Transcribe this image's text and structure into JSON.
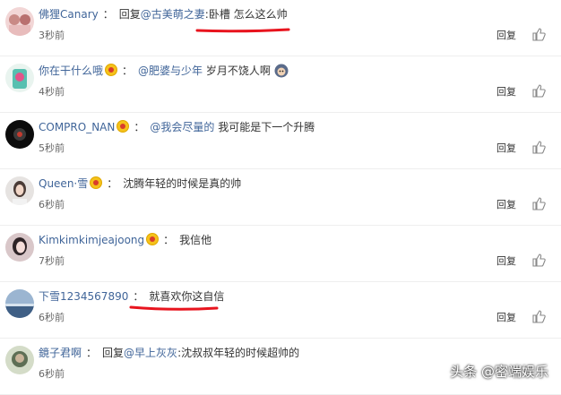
{
  "comments": [
    {
      "user": "佛狸Canary",
      "badge": false,
      "prefix": "回复",
      "mention": "@古美萌之妻",
      "mention_suffix": ":",
      "text": "卧槽 怎么这么帅",
      "time": "3秒前"
    },
    {
      "user": "你在干什么哦",
      "badge": true,
      "prefix": "",
      "mention": "@肥婆与少年",
      "mention_suffix": "",
      "text": "岁月不饶人啊",
      "time": "4秒前"
    },
    {
      "user": "COMPRO_NAN",
      "badge": true,
      "prefix": "",
      "mention": "@我会尽量的",
      "mention_suffix": "",
      "text": "我可能是下一个升腾",
      "time": "5秒前"
    },
    {
      "user": "Queen·雪",
      "badge": true,
      "prefix": "",
      "mention": "",
      "mention_suffix": "",
      "text": "沈腾年轻的时候是真的帅",
      "time": "6秒前"
    },
    {
      "user": "Kimkimkimjeajoong",
      "badge": true,
      "prefix": "",
      "mention": "",
      "mention_suffix": "",
      "text": "我信他",
      "time": "7秒前"
    },
    {
      "user": "下雪1234567890",
      "badge": false,
      "prefix": "",
      "mention": "",
      "mention_suffix": "",
      "text": "就喜欢你这自信",
      "time": "6秒前"
    },
    {
      "user": "鏡子君啊",
      "badge": false,
      "prefix": "回复",
      "mention": "@早上灰灰",
      "mention_suffix": ":",
      "text": "沈叔叔年轻的时候超帅的",
      "time": "6秒前"
    }
  ],
  "labels": {
    "separator": "：",
    "reply": "回复"
  },
  "watermark": "头条 @密端娱乐",
  "colors": {
    "link": "#406599",
    "underline": "#e8141e"
  }
}
